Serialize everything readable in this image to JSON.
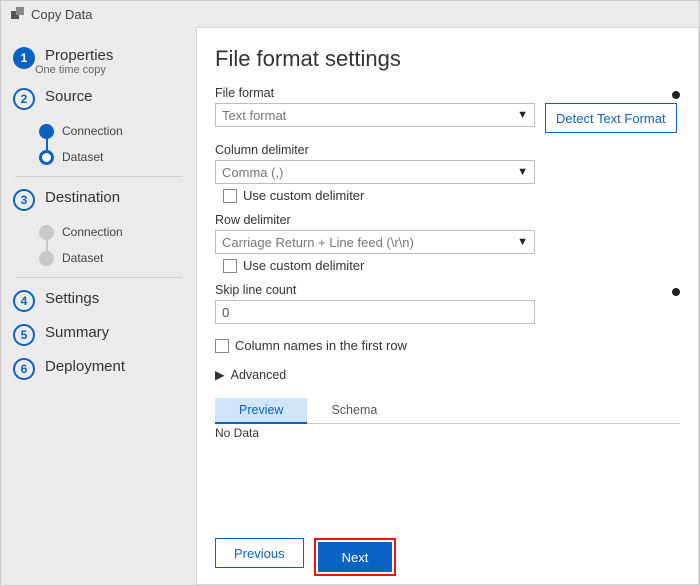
{
  "window": {
    "title": "Copy Data"
  },
  "sidebar": {
    "steps": [
      {
        "num": "1",
        "label": "Properties",
        "sub": "One time copy"
      },
      {
        "num": "2",
        "label": "Source"
      },
      {
        "num": "3",
        "label": "Destination"
      },
      {
        "num": "4",
        "label": "Settings"
      },
      {
        "num": "5",
        "label": "Summary"
      },
      {
        "num": "6",
        "label": "Deployment"
      }
    ],
    "source_subs": [
      "Connection",
      "Dataset"
    ],
    "dest_subs": [
      "Connection",
      "Dataset"
    ]
  },
  "main": {
    "heading": "File format settings",
    "detect_btn": "Detect Text Format",
    "file_format": {
      "label": "File format",
      "value": "Text format"
    },
    "col_delim": {
      "label": "Column delimiter",
      "value": "Comma (,)",
      "custom_label": "Use custom delimiter"
    },
    "row_delim": {
      "label": "Row delimiter",
      "value": "Carriage Return + Line feed (\\r\\n)",
      "custom_label": "Use custom delimiter"
    },
    "skip": {
      "label": "Skip line count",
      "value": "0"
    },
    "first_row_names": "Column names in the first row",
    "advanced": "Advanced",
    "tabs": {
      "preview": "Preview",
      "schema": "Schema"
    },
    "empty": "No Data"
  },
  "footer": {
    "previous": "Previous",
    "next": "Next"
  }
}
